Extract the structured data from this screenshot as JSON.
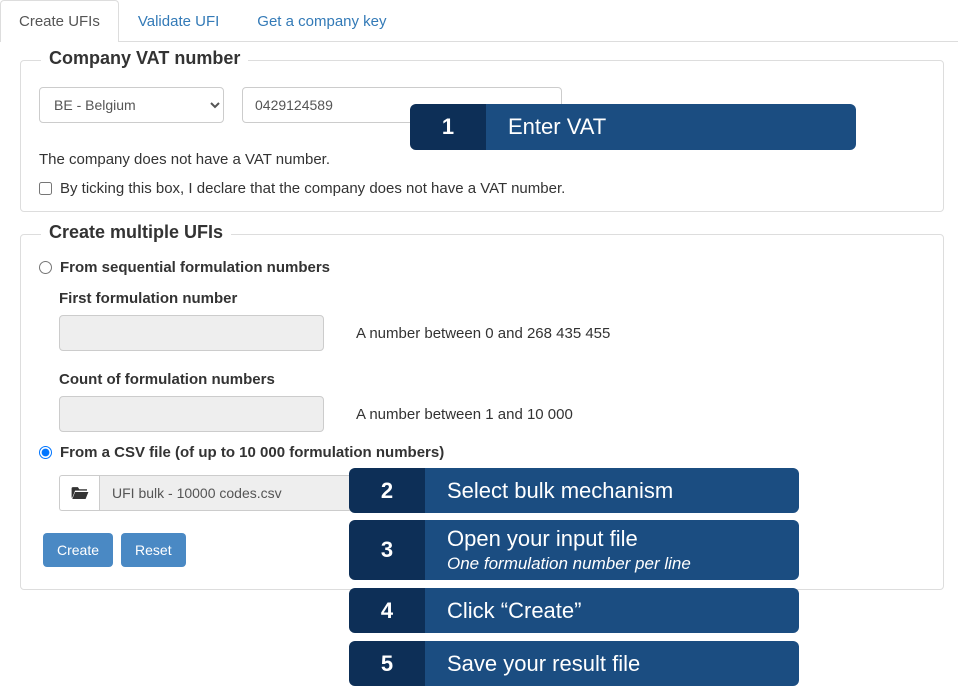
{
  "tabs": {
    "create": "Create UFIs",
    "validate": "Validate UFI",
    "company_key": "Get a company key"
  },
  "vat_section": {
    "legend": "Company VAT number",
    "country_selected": "BE - Belgium",
    "vat_value": "0429124589",
    "no_vat_text": "The company does not have a VAT number.",
    "declare_label": "By ticking this box, I declare that the company does not have a VAT number."
  },
  "multi_section": {
    "legend": "Create multiple UFIs",
    "radio_sequential": "From sequential formulation numbers",
    "first_label": "First formulation number",
    "first_hint": "A number between 0 and 268 435 455",
    "count_label": "Count of formulation numbers",
    "count_hint": "A number between 1 and 10 000",
    "radio_csv": "From a CSV file (of up to 10 000 formulation numbers)",
    "file_name": "UFI bulk - 10000 codes.csv",
    "create_btn": "Create",
    "reset_btn": "Reset"
  },
  "annotations": {
    "a1": {
      "num": "1",
      "text": "Enter VAT"
    },
    "a2": {
      "num": "2",
      "text": "Select bulk mechanism"
    },
    "a3": {
      "num": "3",
      "text": "Open your input file",
      "sub": "One formulation number per line"
    },
    "a4": {
      "num": "4",
      "text": "Click “Create”"
    },
    "a5": {
      "num": "5",
      "text": "Save your result file"
    }
  }
}
